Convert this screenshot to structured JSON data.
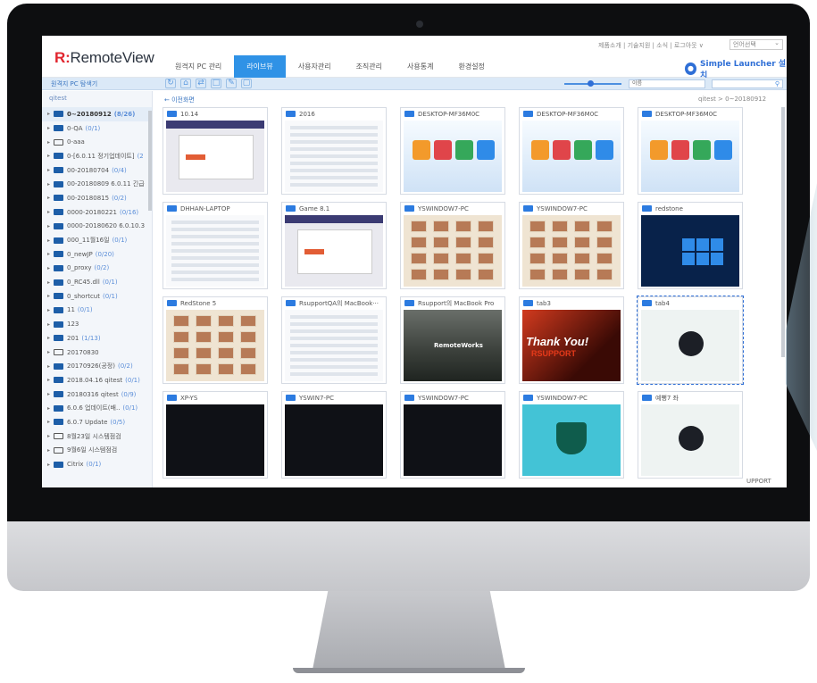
{
  "app": {
    "logo_mark": "R:",
    "logo_text": "RemoteView",
    "top_links": "제품소개  |  기술지원  |  소식  |  로그아웃  ∨",
    "language": "언어선택",
    "launcher": "Simple Launcher 설치"
  },
  "menu": [
    {
      "label": "원격지 PC 관리",
      "active": false
    },
    {
      "label": "라이브뷰",
      "active": true
    },
    {
      "label": "사용자관리",
      "active": false
    },
    {
      "label": "조직관리",
      "active": false
    },
    {
      "label": "사용통계",
      "active": false
    },
    {
      "label": "환경설정",
      "active": false
    }
  ],
  "toolbar": {
    "title": "원격지 PC 탐색기",
    "sort_label": "이름",
    "search_icon": "search-icon"
  },
  "sidebar": {
    "root": "qitest",
    "items": [
      {
        "label": "0~20180912",
        "count": "(8/26)",
        "selected": true,
        "hollow": false
      },
      {
        "label": "0-QA",
        "count": "(0/1)",
        "selected": false,
        "hollow": false
      },
      {
        "label": "0-aaa",
        "count": "",
        "selected": false,
        "hollow": true
      },
      {
        "label": "0-[6.0.11 정기업데이트]",
        "count": "(2",
        "selected": false,
        "hollow": false
      },
      {
        "label": "00-20180704",
        "count": "(0/4)",
        "selected": false,
        "hollow": false
      },
      {
        "label": "00-20180809 6.0.11 긴급",
        "count": "",
        "selected": false,
        "hollow": false
      },
      {
        "label": "00-20180815",
        "count": "(0/2)",
        "selected": false,
        "hollow": false
      },
      {
        "label": "0000-20180221",
        "count": "(0/16)",
        "selected": false,
        "hollow": false
      },
      {
        "label": "0000-20180620 6.0.10.3",
        "count": "",
        "selected": false,
        "hollow": false
      },
      {
        "label": "000_11월16일",
        "count": "(0/1)",
        "selected": false,
        "hollow": false
      },
      {
        "label": "0_newJP",
        "count": "(0/20)",
        "selected": false,
        "hollow": false
      },
      {
        "label": "0_proxy",
        "count": "(0/2)",
        "selected": false,
        "hollow": false
      },
      {
        "label": "0_RC45.dll",
        "count": "(0/1)",
        "selected": false,
        "hollow": false
      },
      {
        "label": "0_shortcut",
        "count": "(0/1)",
        "selected": false,
        "hollow": false
      },
      {
        "label": "11",
        "count": "(0/1)",
        "selected": false,
        "hollow": false
      },
      {
        "label": "123",
        "count": "",
        "selected": false,
        "hollow": false
      },
      {
        "label": "201",
        "count": "(1/13)",
        "selected": false,
        "hollow": false
      },
      {
        "label": "20170830",
        "count": "",
        "selected": false,
        "hollow": true
      },
      {
        "label": "20170926(공정)",
        "count": "(0/2)",
        "selected": false,
        "hollow": false
      },
      {
        "label": "2018.04.16 qitest",
        "count": "(0/1)",
        "selected": false,
        "hollow": false
      },
      {
        "label": "20180316 qitest",
        "count": "(0/9)",
        "selected": false,
        "hollow": false
      },
      {
        "label": "6.0.6 업데이트(배..",
        "count": "(0/1)",
        "selected": false,
        "hollow": false
      },
      {
        "label": "6.0.7 Update",
        "count": "(0/5)",
        "selected": false,
        "hollow": false
      },
      {
        "label": "8월23일 시스템점검",
        "count": "",
        "selected": false,
        "hollow": true
      },
      {
        "label": "9월6일 시스템점검",
        "count": "",
        "selected": false,
        "hollow": true
      },
      {
        "label": "Citrix",
        "count": "(0/1)",
        "selected": false,
        "hollow": false
      }
    ]
  },
  "main": {
    "back_label": "← 이전화면",
    "breadcrumb": "qitest > 0~20180912",
    "tiles": [
      {
        "name": "10.14",
        "thumb": "app"
      },
      {
        "name": "2016",
        "thumb": "list"
      },
      {
        "name": "DESKTOP-MF36M0C",
        "thumb": "blue"
      },
      {
        "name": "DESKTOP-MF36M0C",
        "thumb": "blue"
      },
      {
        "name": "DESKTOP-MF36M0C",
        "thumb": "blue"
      },
      {
        "name": "DHHAN-LAPTOP",
        "thumb": "list"
      },
      {
        "name": "Game 8.1",
        "thumb": "app"
      },
      {
        "name": "YSWINDOW7-PC",
        "thumb": "beige"
      },
      {
        "name": "YSWINDOW7-PC",
        "thumb": "beige"
      },
      {
        "name": "redstone",
        "thumb": "win"
      },
      {
        "name": "RedStone 5",
        "thumb": "beige"
      },
      {
        "name": "RsupportQA의 MacBook···",
        "thumb": "list"
      },
      {
        "name": "Rsupport의 MacBook Pro",
        "thumb": "city"
      },
      {
        "name": "tab3",
        "thumb": "ty"
      },
      {
        "name": "tab4",
        "thumb": "net",
        "selected": true
      },
      {
        "name": "XP-YS",
        "thumb": "dark"
      },
      {
        "name": "YSWIN7-PC",
        "thumb": "dark"
      },
      {
        "name": "YSWINDOW7-PC",
        "thumb": "dark"
      },
      {
        "name": "YSWINDOW7-PC",
        "thumb": "cyan"
      },
      {
        "name": "예뻥7 좌",
        "thumb": "net"
      }
    ],
    "thumb_texts": {
      "ty_title": "Thank You!",
      "ty_sub": "RSUPPORT",
      "city_text": "RemoteWorks",
      "corner_text": "UPPORT"
    }
  }
}
